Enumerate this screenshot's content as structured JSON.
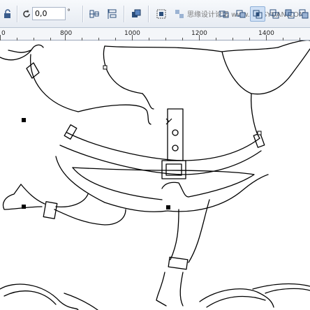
{
  "toolbar": {
    "angle_value": "0,0",
    "angle_unit": "°",
    "watermark": "思缘设计论坛 www.MISSYUAN.COM",
    "icons": [
      "lock-icon",
      "rotate-icon",
      "align-icon",
      "distribute-icon",
      "arrange-icon",
      "group-icon",
      "ungroup-icon",
      "weld-icon",
      "trim-icon",
      "intersect-icon",
      "simplify-icon",
      "front-minus-back-icon",
      "back-minus-front-icon"
    ]
  },
  "ruler": {
    "labels": [
      "0",
      "800",
      "1000",
      "1200",
      "1400"
    ]
  },
  "colors": {
    "toolbar_bg": "#e6ebf2",
    "outline": "#000000",
    "selection_handle": "#000000"
  }
}
